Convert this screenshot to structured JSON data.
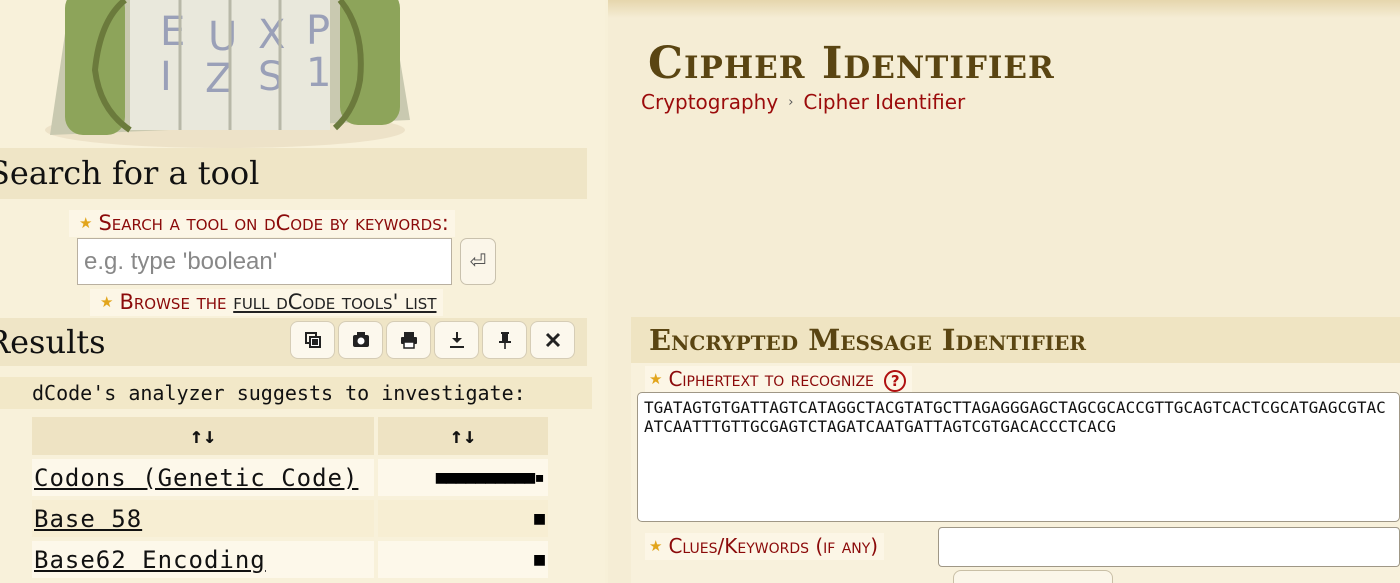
{
  "left": {
    "search_heading": "Search for a tool",
    "search_label": "Search a tool on dCode by keywords:",
    "search_placeholder": "e.g. type 'boolean'",
    "search_go": "⏎",
    "browse_prefix": "Browse the ",
    "browse_link": "full dCode tools' list",
    "results_heading": "Results",
    "toolbar_icons": [
      "copy-icon",
      "screenshot-icon",
      "print-icon",
      "download-icon",
      "pin-icon",
      "close-icon"
    ],
    "analyzer_text": "dCode's analyzer suggests to investigate:",
    "table": {
      "headers": [
        "↑↓",
        "↑↓"
      ],
      "rows": [
        {
          "name": "Codons (Genetic Code)",
          "score": "■■■■■■■■■■▪"
        },
        {
          "name": "Base 58",
          "score": "■"
        },
        {
          "name": "Base62 Encoding",
          "score": "■"
        }
      ]
    }
  },
  "right": {
    "title": "Cipher Identifier",
    "breadcrumb": [
      "Cryptography",
      "›",
      "Cipher Identifier"
    ],
    "tool_heading": "Encrypted Message Identifier",
    "ciphertext_label": "Ciphertext to recognize",
    "help": "?",
    "ciphertext": "TGATAGTGTGATTAGTCATAGGCTACGTATGCTTAGAGGGAGCTAGCGCACCGTTGCAGTCACTCGCATGAGCGTACATCAATTTGTTGCGAGTCTAGATCAATGATTAGTCGTGACACCCTCACG",
    "clues_label": "Clues/Keywords (if any)",
    "clues_value": ""
  },
  "colors": {
    "accent_red": "#8b0a0a",
    "title_brown": "#5a4512",
    "star": "#e2a51c",
    "panel_bg": "#f8f1da"
  }
}
